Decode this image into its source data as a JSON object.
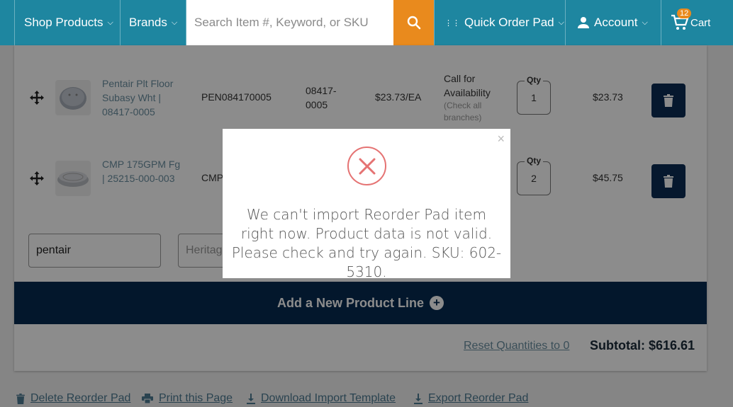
{
  "nav": {
    "shop_products": "Shop Products",
    "brands": "Brands",
    "search_placeholder": "Search Item #, Keyword, or SKU",
    "quick_order_pad": "Quick Order Pad",
    "account": "Account",
    "cart_label": "Cart",
    "cart_count": "12"
  },
  "rows": [
    {
      "name": "Pentair Plt Floor Subasy Wht | 08417-0005",
      "part_number": "PEN084170005",
      "mfr_number": "08417-0005",
      "price": "$23.73/EA",
      "availability": "Call for Availability",
      "availability_note": "(Check all branches)",
      "qty_label": "Qty",
      "qty": "1",
      "total": "$23.73"
    },
    {
      "name": "CMP 175GPM Fg | 25215-000-003",
      "part_number": "CMP",
      "qty_label": "Qty",
      "qty": "2",
      "total": "$45.75"
    }
  ],
  "new_line": {
    "search_value": "pentair",
    "brand_placeholder": "Heritag"
  },
  "add_line_label": "Add a New Product Line",
  "reset_label": "Reset Quantities to 0",
  "subtotal": "Subtotal: $616.61",
  "footer": {
    "delete_label": "Delete Reorder Pad",
    "print_label": "Print this Page",
    "download_label": "Download Import Template",
    "export_label": "Export Reorder Pad"
  },
  "modal": {
    "message": "We can't import Reorder Pad item right now. Product data is not valid. Please check and try again. SKU: 602-5310.",
    "close_glyph": "×"
  },
  "colors": {
    "nav_bg": "#1e86a0",
    "search_btn": "#e98a1d",
    "dark_navy": "#062a50",
    "error_red": "#e57373"
  }
}
